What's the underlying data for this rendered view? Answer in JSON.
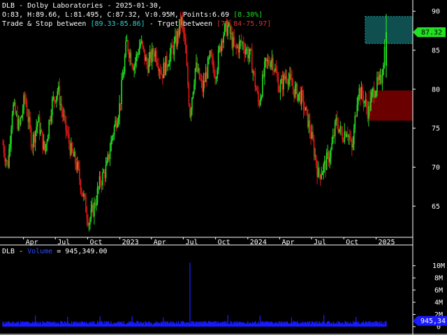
{
  "header": {
    "line1": "DLB - Dolby Laboratories - 2025-01-30,",
    "line2_pre": "O:83, H:89.66, L:81.495, C:87.32, V:0.95M, Points:6.69 ",
    "line2_pct": "[8.30%]",
    "line3_a": "Trade & Stop between ",
    "line3_b": "[89.33-85.86]",
    "line3_c": " - Trget between ",
    "line3_d": "[79.84-75.97]"
  },
  "volume_header": {
    "prefix": "DLB - ",
    "name": "Volume",
    "suffix": " = 945,349.00"
  },
  "colors": {
    "up": "#22e022",
    "down": "#e01818",
    "volume": "#1a1aff",
    "trade_zone": "#0f4f4f",
    "trade_border": "#1fa0a0",
    "target_zone": "#6a0000",
    "price_tag": "#22e022",
    "volume_tag": "#1a1aff"
  },
  "chart_data": [
    {
      "type": "candlestick",
      "ylim": [
        61,
        91
      ],
      "y_ticks": [
        65,
        70,
        75,
        80,
        85,
        90
      ],
      "x_tick_labels": [
        "Apr",
        "Jul",
        "Oct",
        "2023",
        "Apr",
        "Jul",
        "Oct",
        "2024",
        "Apr",
        "Jul",
        "Oct",
        "2025"
      ],
      "x_tick_dates": [
        "2022-04-01",
        "2022-07-01",
        "2022-10-01",
        "2023-01-01",
        "2023-04-01",
        "2023-07-01",
        "2023-10-01",
        "2024-01-01",
        "2024-04-01",
        "2024-07-01",
        "2024-10-01",
        "2025-01-01"
      ],
      "date_range": [
        "2022-02-01",
        "2025-01-30"
      ],
      "last_price": "87.32",
      "trade_zone": [
        85.86,
        89.33
      ],
      "target_zone": [
        75.97,
        79.84
      ],
      "trade_zone_start": "2024-12-01",
      "target_zone_start": "2024-12-10",
      "price_path": [
        [
          "2022-02-01",
          73
        ],
        [
          "2022-02-15",
          70
        ],
        [
          "2022-03-01",
          78
        ],
        [
          "2022-03-20",
          75
        ],
        [
          "2022-04-05",
          79
        ],
        [
          "2022-04-25",
          73
        ],
        [
          "2022-05-12",
          76
        ],
        [
          "2022-06-01",
          72
        ],
        [
          "2022-06-20",
          78
        ],
        [
          "2022-07-08",
          80
        ],
        [
          "2022-07-25",
          76
        ],
        [
          "2022-08-15",
          72
        ],
        [
          "2022-09-01",
          70
        ],
        [
          "2022-09-20",
          66
        ],
        [
          "2022-10-05",
          63
        ],
        [
          "2022-10-20",
          65
        ],
        [
          "2022-11-05",
          68
        ],
        [
          "2022-11-25",
          70
        ],
        [
          "2022-12-10",
          74
        ],
        [
          "2023-01-01",
          78
        ],
        [
          "2023-01-20",
          86
        ],
        [
          "2023-02-10",
          83
        ],
        [
          "2023-03-01",
          86
        ],
        [
          "2023-03-20",
          83
        ],
        [
          "2023-04-10",
          85
        ],
        [
          "2023-05-01",
          82
        ],
        [
          "2023-05-20",
          84
        ],
        [
          "2023-06-10",
          86
        ],
        [
          "2023-06-25",
          89
        ],
        [
          "2023-07-05",
          86
        ],
        [
          "2023-07-20",
          77
        ],
        [
          "2023-08-05",
          83
        ],
        [
          "2023-08-25",
          80
        ],
        [
          "2023-09-15",
          84
        ],
        [
          "2023-10-01",
          82
        ],
        [
          "2023-10-20",
          87
        ],
        [
          "2023-11-05",
          88
        ],
        [
          "2023-11-25",
          85
        ],
        [
          "2023-12-15",
          86
        ],
        [
          "2024-01-10",
          84
        ],
        [
          "2024-02-01",
          78
        ],
        [
          "2024-02-20",
          83
        ],
        [
          "2024-03-10",
          84
        ],
        [
          "2024-04-01",
          80
        ],
        [
          "2024-04-20",
          82
        ],
        [
          "2024-05-10",
          80
        ],
        [
          "2024-06-01",
          79
        ],
        [
          "2024-06-20",
          76
        ],
        [
          "2024-07-05",
          73
        ],
        [
          "2024-07-20",
          69
        ],
        [
          "2024-08-05",
          70
        ],
        [
          "2024-08-25",
          72
        ],
        [
          "2024-09-10",
          76
        ],
        [
          "2024-09-25",
          74
        ],
        [
          "2024-10-10",
          75
        ],
        [
          "2024-10-25",
          72
        ],
        [
          "2024-11-10",
          80
        ],
        [
          "2024-11-25",
          79
        ],
        [
          "2024-12-10",
          77
        ],
        [
          "2024-12-25",
          80
        ],
        [
          "2025-01-15",
          81
        ],
        [
          "2025-01-30",
          87.32
        ]
      ]
    },
    {
      "type": "bar",
      "title": "Volume",
      "y_tick_labels": [
        "0",
        "2M",
        "4M",
        "6M",
        "8M",
        "10M"
      ],
      "ylim": [
        0,
        11
      ],
      "last_value": "945,34",
      "baseline": 0.7,
      "spikes": [
        [
          "2023-07-20",
          10.5
        ],
        [
          "2022-05-05",
          1.8
        ],
        [
          "2022-08-05",
          1.6
        ],
        [
          "2022-11-05",
          1.7
        ],
        [
          "2023-02-05",
          1.7
        ],
        [
          "2023-05-05",
          1.5
        ],
        [
          "2023-11-05",
          1.9
        ],
        [
          "2024-02-05",
          1.8
        ],
        [
          "2024-05-05",
          1.5
        ],
        [
          "2024-08-05",
          1.9
        ],
        [
          "2024-11-05",
          1.6
        ],
        [
          "2025-01-30",
          0.95
        ]
      ]
    }
  ]
}
